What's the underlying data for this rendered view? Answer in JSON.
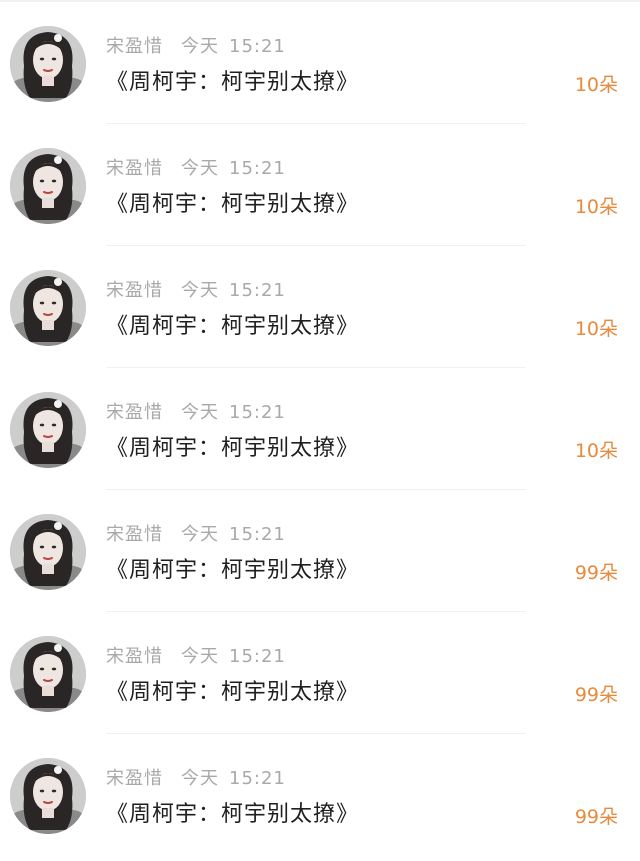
{
  "messages": [
    {
      "sender": "宋盈惜",
      "day": "今天",
      "time": "15:21",
      "title": "《周柯宇：柯宇别太撩》",
      "count": "10朵"
    },
    {
      "sender": "宋盈惜",
      "day": "今天",
      "time": "15:21",
      "title": "《周柯宇：柯宇别太撩》",
      "count": "10朵"
    },
    {
      "sender": "宋盈惜",
      "day": "今天",
      "time": "15:21",
      "title": "《周柯宇：柯宇别太撩》",
      "count": "10朵"
    },
    {
      "sender": "宋盈惜",
      "day": "今天",
      "time": "15:21",
      "title": "《周柯宇：柯宇别太撩》",
      "count": "10朵"
    },
    {
      "sender": "宋盈惜",
      "day": "今天",
      "time": "15:21",
      "title": "《周柯宇：柯宇别太撩》",
      "count": "99朵"
    },
    {
      "sender": "宋盈惜",
      "day": "今天",
      "time": "15:21",
      "title": "《周柯宇：柯宇别太撩》",
      "count": "99朵"
    },
    {
      "sender": "宋盈惜",
      "day": "今天",
      "time": "15:21",
      "title": "《周柯宇：柯宇别太撩》",
      "count": "99朵"
    }
  ],
  "colors": {
    "count_accent": "#e88a3c",
    "meta_text": "#a9a9a9",
    "title_text": "#1f1f1f"
  }
}
